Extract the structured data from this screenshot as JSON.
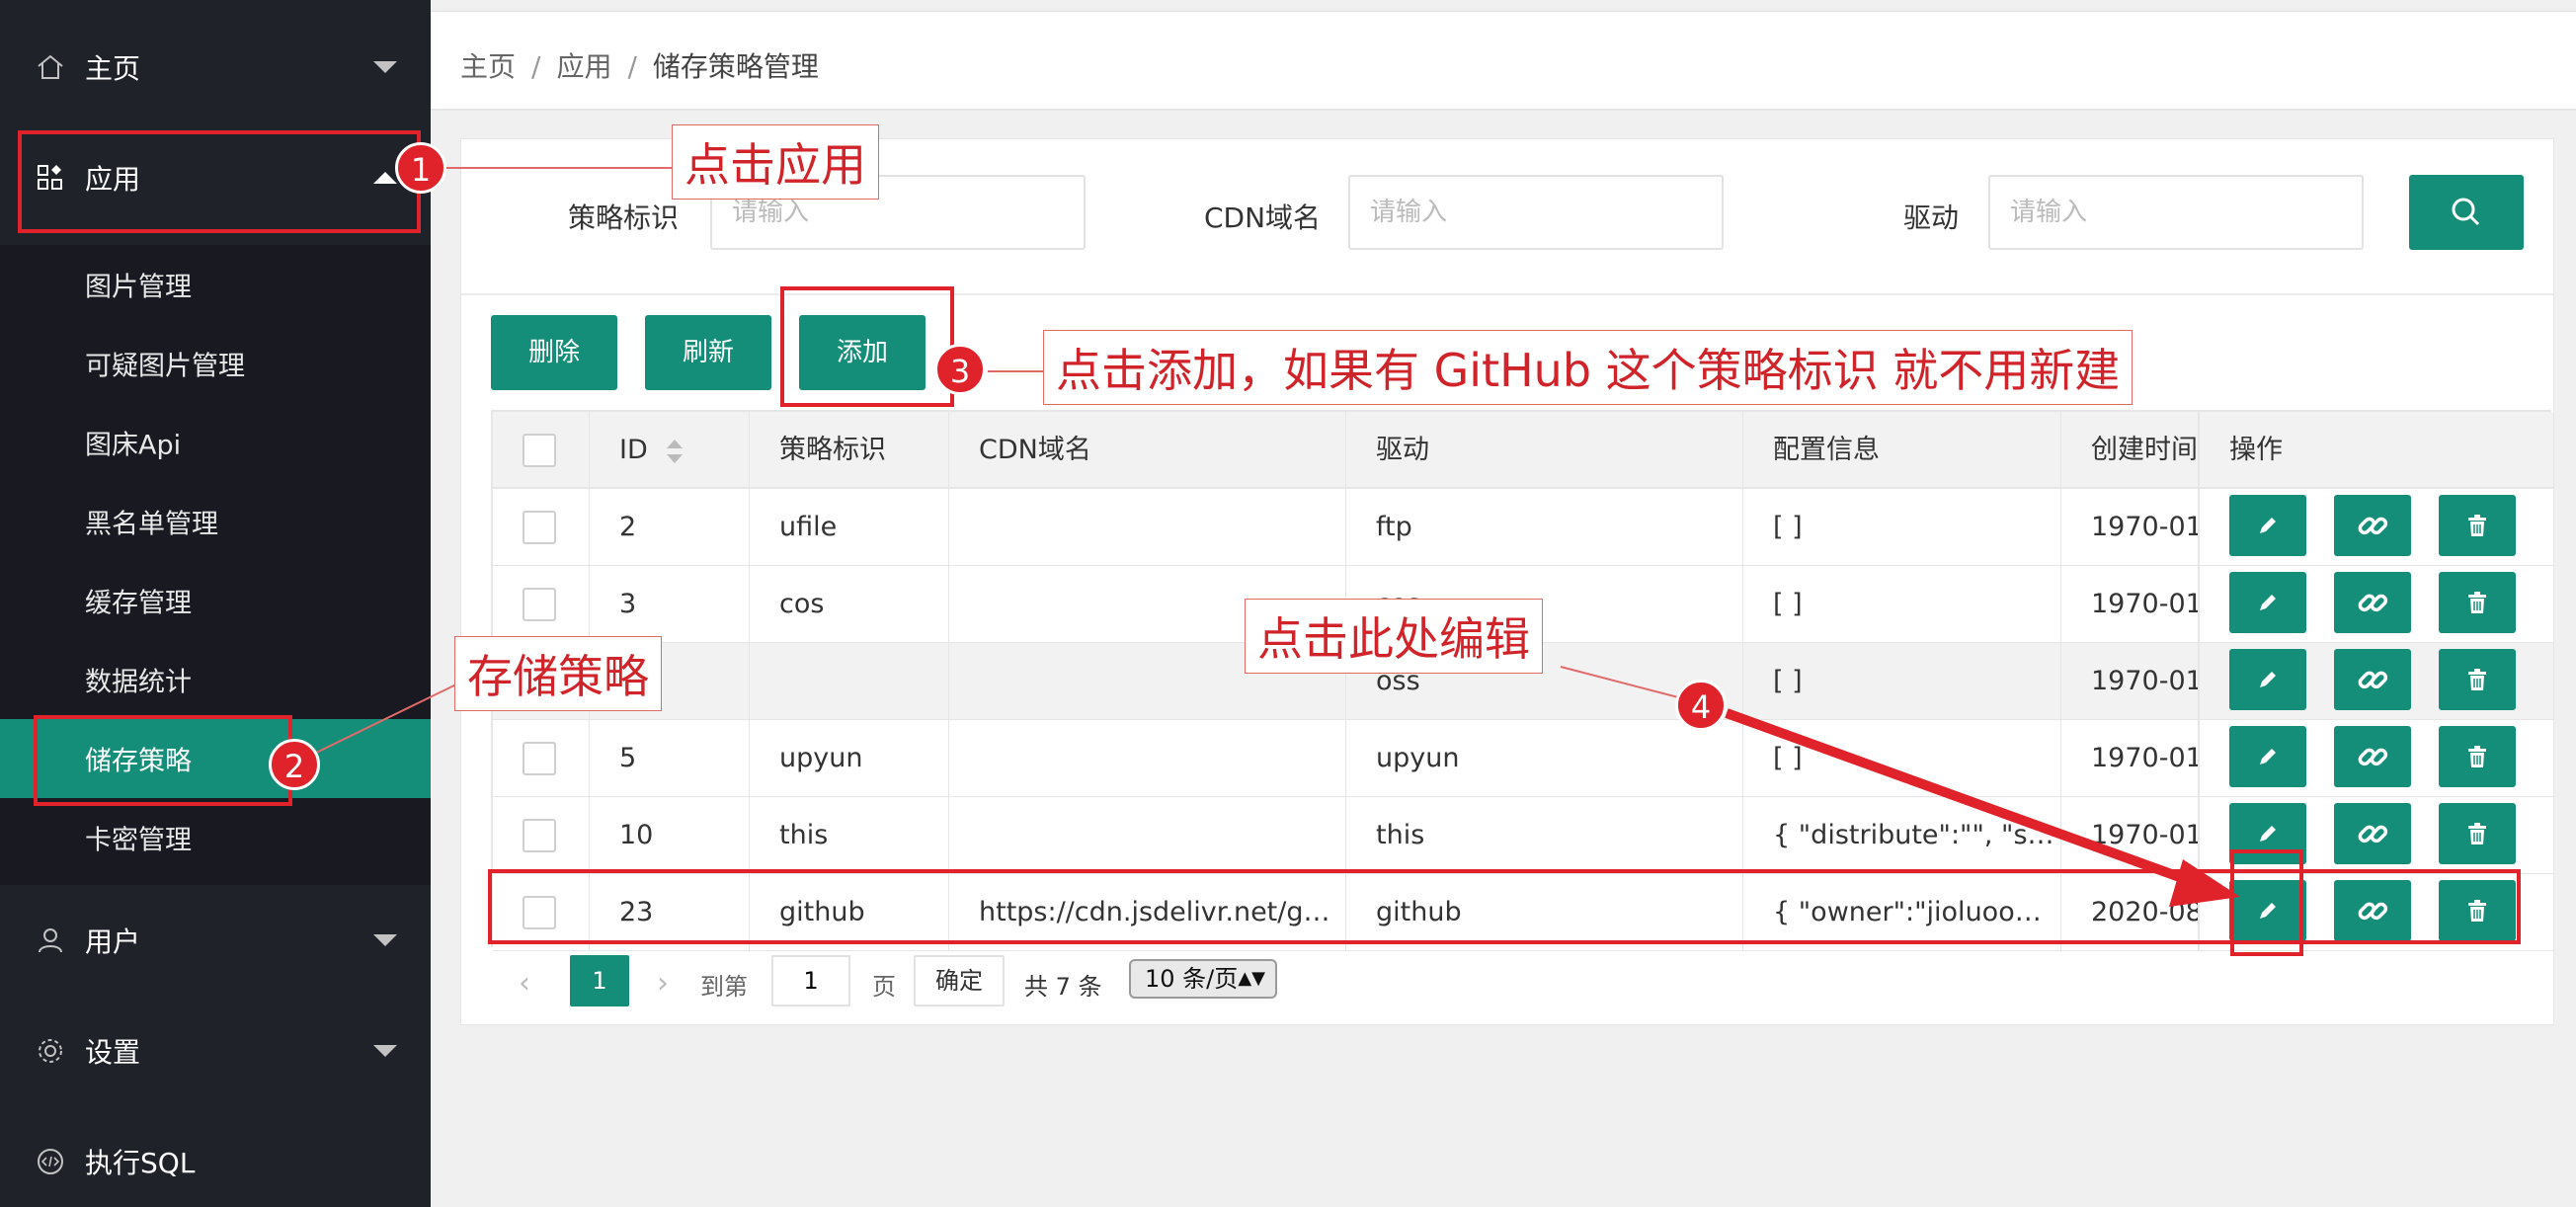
{
  "sidebar": {
    "home": "主页",
    "app": "应用",
    "sub_items": [
      "图片管理",
      "可疑图片管理",
      "图床Api",
      "黑名单管理",
      "缓存管理",
      "数据统计",
      "储存策略",
      "卡密管理"
    ],
    "user": "用户",
    "settings": "设置",
    "sql": "执行SQL"
  },
  "breadcrumb": {
    "home": "主页",
    "sep": "/",
    "app": "应用",
    "current": "储存策略管理"
  },
  "search": {
    "key_label": "策略标识",
    "key_placeholder": "请输入",
    "cdn_label": "CDN域名",
    "cdn_placeholder": "请输入",
    "driver_label": "驱动",
    "driver_placeholder": "请输入"
  },
  "toolbar": {
    "delete": "删除",
    "refresh": "刷新",
    "add": "添加"
  },
  "table": {
    "headers": {
      "id": "ID",
      "key": "策略标识",
      "cdn": "CDN域名",
      "driver": "驱动",
      "config": "配置信息",
      "created": "创建时间",
      "ops": "操作"
    },
    "rows": [
      {
        "id": "2",
        "key": "ufile",
        "cdn": "",
        "driver": "ftp",
        "config": "[ ]",
        "created": "1970-01"
      },
      {
        "id": "3",
        "key": "cos",
        "cdn": "",
        "driver": "cos",
        "config": "[ ]",
        "created": "1970-01"
      },
      {
        "id": "",
        "key": "",
        "cdn": "",
        "driver": "oss",
        "config": "[ ]",
        "created": "1970-01"
      },
      {
        "id": "5",
        "key": "upyun",
        "cdn": "",
        "driver": "upyun",
        "config": "[ ]",
        "created": "1970-01"
      },
      {
        "id": "10",
        "key": "this",
        "cdn": "",
        "driver": "this",
        "config": "{ \"distribute\":\"\", \"s…",
        "created": "1970-01"
      },
      {
        "id": "23",
        "key": "github",
        "cdn": "https://cdn.jsdelivr.net/g…",
        "driver": "github",
        "config": "{ \"owner\":\"jioluoo…",
        "created": "2020-08"
      }
    ]
  },
  "pager": {
    "current": "1",
    "goto": "到第",
    "page_value": "1",
    "page_unit": "页",
    "confirm": "确定",
    "total": "共 7 条",
    "size": "10 条/页"
  },
  "annotations": {
    "click_app": "点击应用",
    "storage": "存储策略",
    "click_add": "点击添加，如果有 GitHub 这个策略标识 就不用新建",
    "click_edit": "点击此处编辑",
    "n1": "1",
    "n2": "2",
    "n3": "3",
    "n4": "4"
  },
  "colors": {
    "accent": "#158e79",
    "sidebar": "#20222a",
    "annotation": "#e0222a"
  }
}
